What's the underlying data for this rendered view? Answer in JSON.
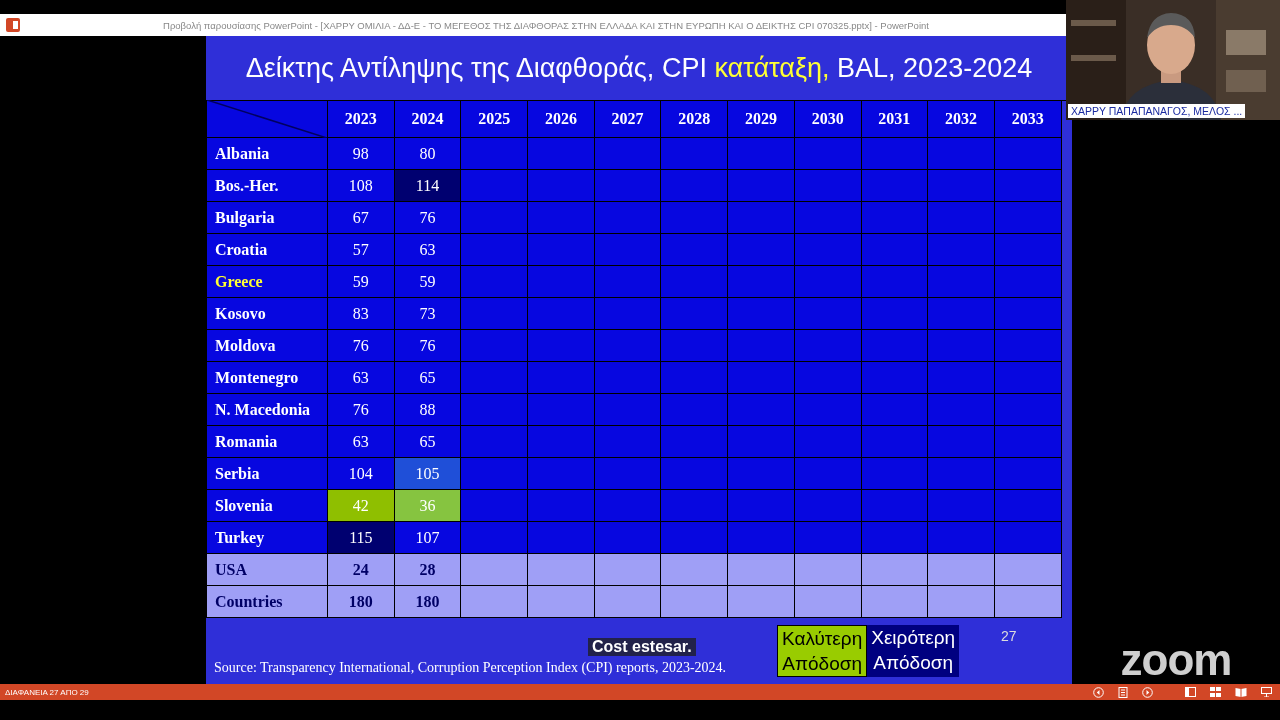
{
  "window": {
    "title": "Προβολή παρουσίασης PowerPoint - [ΧΑΡΡΥ  ΟΜΙΛΙΑ - ΔΔ-Ε - ΤΟ ΜΕΓΕΘΟΣ ΤΗΣ ΔΙΑΦΘΟΡΑΣ ΣΤΗΝ ΕΛΛΑΔΑ ΚΑΙ ΣΤΗΝ ΕΥΡΩΠΗ ΚΑΙ Ο ΔΕΙΚΤΗΣ CPI 070325.pptx] - PowerPoint"
  },
  "slide": {
    "title": [
      {
        "text": "Δείκτης Αντίληψης της Διαφθοράς, CPI ",
        "highlight": false
      },
      {
        "text": "κατάταξη,",
        "highlight": true
      },
      {
        "text": " BAL, 2023-2024",
        "highlight": false
      }
    ],
    "table": {
      "columns": [
        "2023",
        "2024",
        "2025",
        "2026",
        "2027",
        "2028",
        "2029",
        "2030",
        "2031",
        "2032",
        "2033"
      ],
      "rows": [
        {
          "country": "Albania",
          "highlight": false,
          "kind": "country",
          "values": [
            {
              "text": "98",
              "color": "#0707e0"
            },
            {
              "text": "80",
              "color": "#0707e0"
            }
          ]
        },
        {
          "country": "Bos.-Her.",
          "highlight": false,
          "kind": "country",
          "values": [
            {
              "text": "108",
              "color": "#0707e0"
            },
            {
              "text": "114",
              "color": "#000070"
            }
          ]
        },
        {
          "country": "Bulgaria",
          "highlight": false,
          "kind": "country",
          "values": [
            {
              "text": "67",
              "color": "#0707e0"
            },
            {
              "text": "76",
              "color": "#0707e0"
            }
          ]
        },
        {
          "country": "Croatia",
          "highlight": false,
          "kind": "country",
          "values": [
            {
              "text": "57",
              "color": "#0707e0"
            },
            {
              "text": "63",
              "color": "#0707e0"
            }
          ]
        },
        {
          "country": "Greece",
          "highlight": true,
          "kind": "country",
          "values": [
            {
              "text": "59",
              "color": "#0707e0"
            },
            {
              "text": "59",
              "color": "#0707e0"
            }
          ]
        },
        {
          "country": "Kosovo",
          "highlight": false,
          "kind": "country",
          "values": [
            {
              "text": "83",
              "color": "#0707e0"
            },
            {
              "text": "73",
              "color": "#0707e0"
            }
          ]
        },
        {
          "country": "Moldova",
          "highlight": false,
          "kind": "country",
          "values": [
            {
              "text": "76",
              "color": "#0707e0"
            },
            {
              "text": "76",
              "color": "#0707e0"
            }
          ]
        },
        {
          "country": "Montenegro",
          "highlight": false,
          "kind": "country",
          "values": [
            {
              "text": "63",
              "color": "#0707e0"
            },
            {
              "text": "65",
              "color": "#0707e0"
            }
          ]
        },
        {
          "country": "N. Macedonia",
          "highlight": false,
          "kind": "country",
          "values": [
            {
              "text": "76",
              "color": "#0707e0"
            },
            {
              "text": "88",
              "color": "#0707e0"
            }
          ]
        },
        {
          "country": "Romania",
          "highlight": false,
          "kind": "country",
          "values": [
            {
              "text": "63",
              "color": "#0707e0"
            },
            {
              "text": "65",
              "color": "#0707e0"
            }
          ]
        },
        {
          "country": "Serbia",
          "highlight": false,
          "kind": "country",
          "values": [
            {
              "text": "104",
              "color": "#0707e0"
            },
            {
              "text": "105",
              "color": "#1f4fd8"
            }
          ]
        },
        {
          "country": "Slovenia",
          "highlight": false,
          "kind": "country",
          "values": [
            {
              "text": "42",
              "color": "#8fbf00"
            },
            {
              "text": "36",
              "color": "#86c440"
            }
          ]
        },
        {
          "country": "Turkey",
          "highlight": false,
          "kind": "country",
          "values": [
            {
              "text": "115",
              "color": "#000070"
            },
            {
              "text": "107",
              "color": "#0707e0"
            }
          ]
        },
        {
          "country": "USA",
          "kind": "summary",
          "values": [
            {
              "text": "24",
              "color": "#9f9ff6"
            },
            {
              "text": "28",
              "color": "#9f9ff6"
            }
          ]
        },
        {
          "country": "Countries",
          "kind": "summary",
          "values": [
            {
              "text": "180",
              "color": "#9f9ff6"
            },
            {
              "text": "180",
              "color": "#9f9ff6"
            }
          ]
        }
      ]
    },
    "source": "Source: Transparency International, Corruption Perception Index (CPI) reports, 2023-2024.",
    "caption": "Cost estesar.",
    "legend": [
      {
        "line1": "Καλύτερη",
        "line2": "Απόδοση",
        "kind": "better"
      },
      {
        "line1": "Χειρότερη",
        "line2": "Απόδοση",
        "kind": "worse"
      }
    ],
    "slide_number": "27"
  },
  "participant": {
    "name": "ΧΑΡΡΥ ΠΑΠΑΠΑΝΑΓΟΣ, ΜΕΛΟΣ ..."
  },
  "zoom_logo": "zoom",
  "status_bar": {
    "slide_counter": "ΔΙΑΦΑΝΕΙΑ 27 ΑΠΟ 29"
  }
}
